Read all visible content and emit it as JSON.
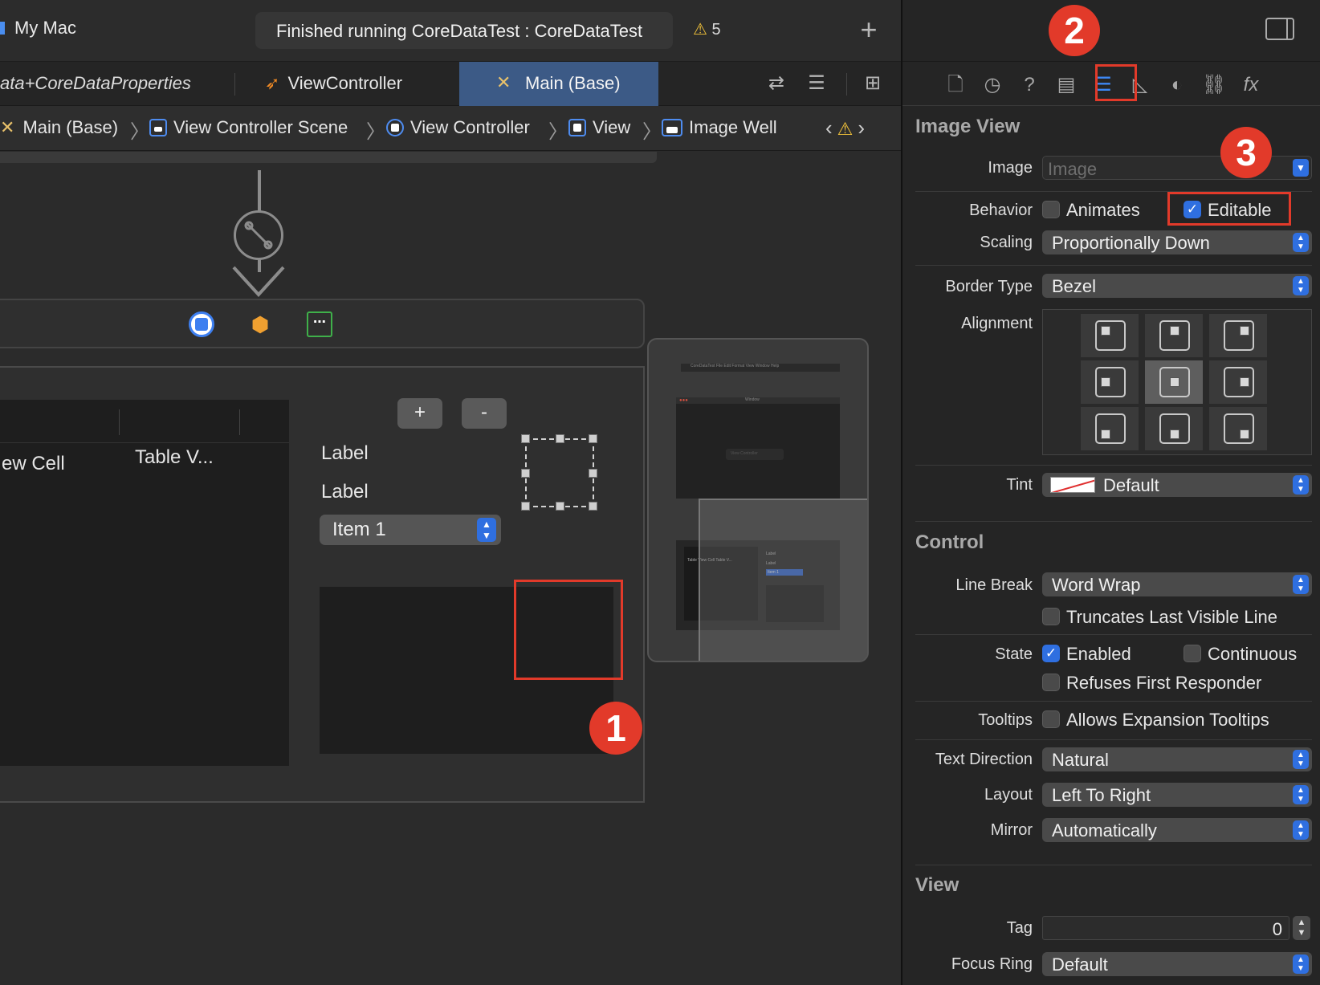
{
  "toolbar": {
    "scheme_destination": "My Mac",
    "status": "Finished running CoreDataTest : CoreDataTest",
    "warning_count": "5",
    "add_symbol": "+"
  },
  "tabs": [
    {
      "label": "ata+CoreDataProperties"
    },
    {
      "label": "ViewController"
    },
    {
      "label": "Main (Base)"
    }
  ],
  "breadcrumb": [
    {
      "label": "Main (Base)"
    },
    {
      "label": "View Controller Scene"
    },
    {
      "label": "View Controller"
    },
    {
      "label": "View"
    },
    {
      "label": "Image Well"
    }
  ],
  "canvas": {
    "table_cell_1": "ew Cell",
    "table_cell_2": "Table V...",
    "plus_label": "+",
    "minus_label": "-",
    "label_1": "Label",
    "label_2": "Label",
    "popup_value": "Item 1",
    "dock_exit_symbol": "⋯"
  },
  "minimap": {
    "menu_text": "CoreDataTest   File   Edit   Format   View   Window   Help",
    "window_title": "Window",
    "vc_button": "View Controller",
    "cell_text": "Table View Cell    Table V...",
    "label_a": "Label",
    "label_b": "Label",
    "item": "Item 1"
  },
  "annotations": {
    "badge_1": "1",
    "badge_2": "2",
    "badge_3": "3"
  },
  "inspector": {
    "image_view": {
      "title": "Image View",
      "image_label": "Image",
      "image_placeholder": "Image",
      "behavior_label": "Behavior",
      "animates_label": "Animates",
      "animates_checked": false,
      "editable_label": "Editable",
      "editable_checked": true,
      "scaling_label": "Scaling",
      "scaling_value": "Proportionally Down",
      "border_type_label": "Border Type",
      "border_type_value": "Bezel",
      "alignment_label": "Alignment",
      "alignment_selected": "center",
      "tint_label": "Tint",
      "tint_value": "Default"
    },
    "control": {
      "title": "Control",
      "line_break_label": "Line Break",
      "line_break_value": "Word Wrap",
      "truncates_label": "Truncates Last Visible Line",
      "state_label": "State",
      "enabled_label": "Enabled",
      "enabled_checked": true,
      "continuous_label": "Continuous",
      "refuses_label": "Refuses First Responder",
      "tooltips_label": "Tooltips",
      "allows_expansion_label": "Allows Expansion Tooltips",
      "text_direction_label": "Text Direction",
      "text_direction_value": "Natural",
      "layout_label": "Layout",
      "layout_value": "Left To Right",
      "mirror_label": "Mirror",
      "mirror_value": "Automatically"
    },
    "view": {
      "title": "View",
      "tag_label": "Tag",
      "tag_value": "0",
      "focus_ring_label": "Focus Ring",
      "focus_ring_value": "Default"
    }
  },
  "colors": {
    "accent": "#2f6fe0",
    "highlight": "#e23a2a",
    "active_tab": "#3c5a86",
    "warning": "#f2c23a"
  }
}
